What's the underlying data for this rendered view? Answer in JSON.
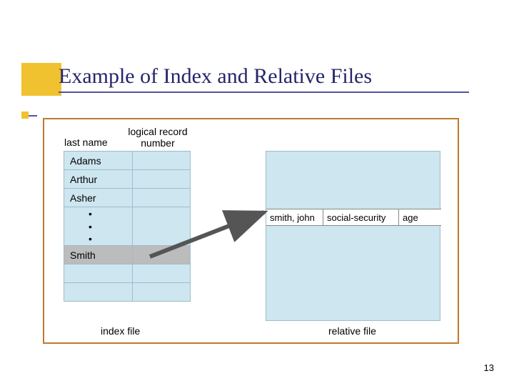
{
  "title": "Example of Index and Relative Files",
  "headers": {
    "last_name": "last name",
    "logical_record_number": "logical record\nnumber"
  },
  "index_rows": [
    {
      "name": "Adams"
    },
    {
      "name": "Arthur"
    },
    {
      "name": "Asher"
    }
  ],
  "selected_row": {
    "name": "Smith"
  },
  "relative_record": {
    "name": "smith, john",
    "field1": "social-security",
    "field2": "age"
  },
  "captions": {
    "index": "index file",
    "relative": "relative file"
  },
  "page_number": "13"
}
